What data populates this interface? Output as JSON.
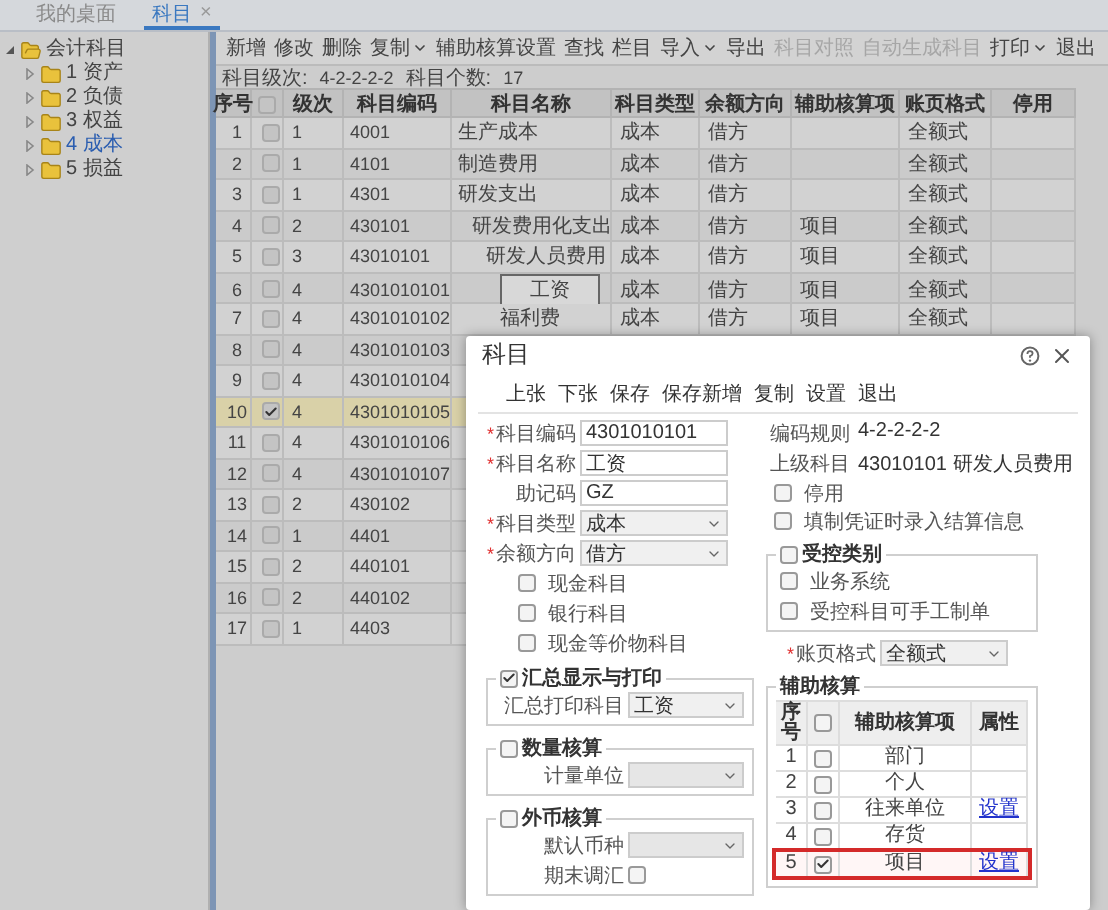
{
  "tabs": [
    {
      "label": "我的桌面",
      "selected": false
    },
    {
      "label": "科目",
      "selected": true,
      "close": "×"
    }
  ],
  "tree": {
    "label": "会计科目",
    "expanded": true,
    "selected": false,
    "children": [
      {
        "label": "1 资产",
        "expanded": false,
        "selected": false
      },
      {
        "label": "2 负债",
        "expanded": false,
        "selected": false
      },
      {
        "label": "3 权益",
        "expanded": false,
        "selected": false
      },
      {
        "label": "4 成本",
        "expanded": false,
        "selected": true
      },
      {
        "label": "5 损益",
        "expanded": false,
        "selected": false
      }
    ]
  },
  "toolbar": [
    {
      "label": "新增",
      "disabled": false,
      "dropdown": false
    },
    {
      "label": "修改",
      "disabled": false,
      "dropdown": false
    },
    {
      "label": "删除",
      "disabled": false,
      "dropdown": false
    },
    {
      "label": "复制",
      "disabled": false,
      "dropdown": true
    },
    {
      "label": "辅助核算设置",
      "disabled": false,
      "dropdown": false
    },
    {
      "label": "查找",
      "disabled": false,
      "dropdown": false
    },
    {
      "label": "栏目",
      "disabled": false,
      "dropdown": false
    },
    {
      "label": "导入",
      "disabled": false,
      "dropdown": true
    },
    {
      "label": "导出",
      "disabled": false,
      "dropdown": false
    },
    {
      "label": "科目对照",
      "disabled": true,
      "dropdown": false
    },
    {
      "label": "自动生成科目",
      "disabled": true,
      "dropdown": false
    },
    {
      "label": "打印",
      "disabled": false,
      "dropdown": true
    },
    {
      "label": "退出",
      "disabled": false,
      "dropdown": false
    }
  ],
  "summary": {
    "grade_label": "科目级次:",
    "grade_value": "4-2-2-2-2",
    "count_label": "科目个数:",
    "count_value": "17"
  },
  "table": {
    "columns": [
      {
        "kind": "text",
        "label": "序号"
      },
      {
        "kind": "checkbox",
        "checked": false
      },
      {
        "kind": "text",
        "label": "级次"
      },
      {
        "kind": "text",
        "label": "科目编码"
      },
      {
        "kind": "text",
        "label": "科目名称"
      },
      {
        "kind": "text",
        "label": "科目类型"
      },
      {
        "kind": "text",
        "label": "余额方向"
      },
      {
        "kind": "text",
        "label": "辅助核算项"
      },
      {
        "kind": "text",
        "label": "账页格式"
      },
      {
        "kind": "text",
        "label": "停用"
      }
    ],
    "rows": [
      {
        "no": "1",
        "checked": false,
        "selected": false,
        "grade": "1",
        "code": "4001",
        "name": "生产成本",
        "type": "成本",
        "direction": "借方",
        "format": "全额式",
        "focused": false
      },
      {
        "no": "2",
        "checked": false,
        "selected": false,
        "grade": "1",
        "code": "4101",
        "name": "制造费用",
        "type": "成本",
        "direction": "借方",
        "format": "全额式",
        "focused": false
      },
      {
        "no": "3",
        "checked": false,
        "selected": false,
        "grade": "1",
        "code": "4301",
        "name": "研发支出",
        "type": "成本",
        "direction": "借方",
        "format": "全额式",
        "focused": false
      },
      {
        "no": "4",
        "checked": false,
        "selected": false,
        "grade": "2",
        "code": "430101",
        "name": "研发费用化支出",
        "type": "成本",
        "direction": "借方",
        "aux": "项目",
        "format": "全额式",
        "focused": false
      },
      {
        "no": "5",
        "checked": false,
        "selected": false,
        "grade": "3",
        "code": "43010101",
        "name": "研发人员费用",
        "type": "成本",
        "direction": "借方",
        "aux": "项目",
        "format": "全额式",
        "focused": false
      },
      {
        "no": "6",
        "checked": false,
        "selected": false,
        "grade": "4",
        "code": "4301010101",
        "name": "工资",
        "type": "成本",
        "direction": "借方",
        "aux": "项目",
        "format": "全额式",
        "focused": true
      },
      {
        "no": "7",
        "checked": false,
        "selected": false,
        "grade": "4",
        "code": "4301010102",
        "name": "福利费",
        "type": "成本",
        "direction": "借方",
        "aux": "项目",
        "format": "全额式",
        "focused": false
      },
      {
        "no": "8",
        "checked": false,
        "selected": false,
        "grade": "4",
        "code": "4301010103"
      },
      {
        "no": "9",
        "checked": false,
        "selected": false,
        "grade": "4",
        "code": "4301010104"
      },
      {
        "no": "10",
        "checked": true,
        "selected": true,
        "grade": "4",
        "code": "4301010105"
      },
      {
        "no": "11",
        "checked": false,
        "selected": false,
        "grade": "4",
        "code": "4301010106"
      },
      {
        "no": "12",
        "checked": false,
        "selected": false,
        "grade": "4",
        "code": "4301010107"
      },
      {
        "no": "13",
        "checked": false,
        "selected": false,
        "grade": "2",
        "code": "430102"
      },
      {
        "no": "14",
        "checked": false,
        "selected": false,
        "grade": "1",
        "code": "4401"
      },
      {
        "no": "15",
        "checked": false,
        "selected": false,
        "grade": "2",
        "code": "440101"
      },
      {
        "no": "16",
        "checked": false,
        "selected": false,
        "grade": "2",
        "code": "440102"
      },
      {
        "no": "17",
        "checked": false,
        "selected": false,
        "grade": "1",
        "code": "4403"
      }
    ]
  },
  "dialog": {
    "title": "科目",
    "required_mark": "*",
    "toolbar": [
      "上张",
      "下张",
      "保存",
      "保存新增",
      "复制",
      "设置",
      "退出"
    ],
    "fields": [
      {
        "label": "科目编码",
        "required": true,
        "kind": "input",
        "value": "4301010101"
      },
      {
        "label": "科目名称",
        "required": true,
        "kind": "input",
        "value": "工资"
      },
      {
        "label": "助记码",
        "required": false,
        "kind": "input",
        "value": "GZ"
      },
      {
        "label": "科目类型",
        "required": true,
        "kind": "select",
        "value": "成本"
      },
      {
        "label": "余额方向",
        "required": true,
        "kind": "select",
        "value": "借方"
      }
    ],
    "options": [
      {
        "label": "现金科目",
        "checked": false
      },
      {
        "label": "银行科目",
        "checked": false
      },
      {
        "label": "现金等价物科目",
        "checked": false
      }
    ],
    "summary_print": {
      "legend": "汇总显示与打印",
      "checked": true,
      "label": "汇总打印科目",
      "value": "工资"
    },
    "quantity": {
      "legend": "数量核算",
      "checked": false,
      "label": "计量单位"
    },
    "currency": {
      "legend": "外币核算",
      "checked": false,
      "label": "默认币种",
      "adjust_label": "期末调汇",
      "adjust_checked": false
    },
    "code_rule": {
      "label": "编码规则",
      "value": "4-2-2-2-2"
    },
    "parent": {
      "label": "上级科目",
      "value": "43010101 研发人员费用"
    },
    "flags": [
      {
        "label": "停用",
        "checked": false
      },
      {
        "label": "填制凭证时录入结算信息",
        "checked": false
      }
    ],
    "controlled": {
      "legend": "受控类别",
      "checked": false,
      "options": [
        {
          "label": "业务系统",
          "checked": false
        },
        {
          "label": "受控科目可手工制单",
          "checked": false
        }
      ]
    },
    "ledger_format": {
      "label": "账页格式",
      "required": true,
      "value": "全额式"
    },
    "aux": {
      "legend": "辅助核算",
      "columns": [
        "序号",
        "辅助核算项",
        "属性"
      ],
      "all_checked": false,
      "rows": [
        {
          "no": "1",
          "item": "部门",
          "checked": false,
          "highlighted": false
        },
        {
          "no": "2",
          "item": "个人",
          "checked": false,
          "highlighted": false
        },
        {
          "no": "3",
          "item": "往来单位",
          "checked": false,
          "link": "设置",
          "highlighted": false
        },
        {
          "no": "4",
          "item": "存货",
          "checked": false,
          "highlighted": false
        },
        {
          "no": "5",
          "item": "项目",
          "checked": true,
          "link": "设置",
          "highlighted": true
        }
      ]
    }
  }
}
